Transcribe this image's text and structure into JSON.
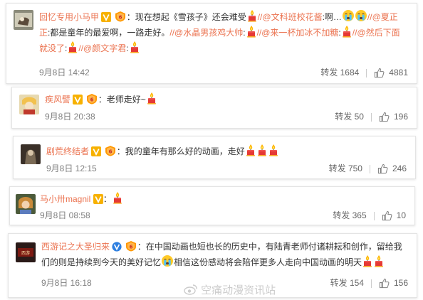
{
  "comments": [
    {
      "user": "回忆专用小马甲",
      "text_a": "：现在想起《雪孩子》还会难受",
      "m1": "//@文科班校花酱",
      "t1": ":啊…",
      "m2": "//@夏正正",
      "t2": ":都是童年的最爱啊，一路走好。",
      "m3": "//@水晶男孩鸡大帅",
      "t3": ":",
      "m4": "//@来一杯加冰不加糖",
      "t4": ":",
      "m5": "//@然后下面就没了",
      "t5": ":",
      "m6": "//@颜文字君",
      "t6": ":",
      "time": "9月8日 14:42",
      "repost": "转发 1684",
      "likes": "4881"
    },
    {
      "user": "疾风譬",
      "text": "：老师走好~",
      "time": "9月8日 20:38",
      "repost": "转发 50",
      "likes": "196"
    },
    {
      "user": "剧荒终结者",
      "text": "：我的童年有那么好的动画，走好",
      "time": "9月8日 12:15",
      "repost": "转发 750",
      "likes": "246"
    },
    {
      "user": "马小卅magnil",
      "text": "：",
      "time": "9月8日 08:58",
      "repost": "转发 365",
      "likes": "10"
    },
    {
      "user": "西游记之大圣归来",
      "text_a": "：在中国动画也短也长的历史中，有陆青老师付诸耕耘和创作，留给我们的则是持续到今天的美好记忆",
      "text_b": "相信这份感动将会陪伴更多人走向中国动画的明天",
      "time": "9月8日 16:18",
      "repost": "转发 154",
      "likes": "156"
    }
  ],
  "watermark": "空痛动漫资讯站",
  "colors": {
    "username": "#eb7350",
    "vbadge": "#f7b100",
    "candle": "#e8442c"
  },
  "icons": [
    "v-badge-icon",
    "level-badge-icon",
    "candle-icon",
    "crying-face-icon",
    "thumbs-up-icon",
    "weibo-logo-icon"
  ]
}
